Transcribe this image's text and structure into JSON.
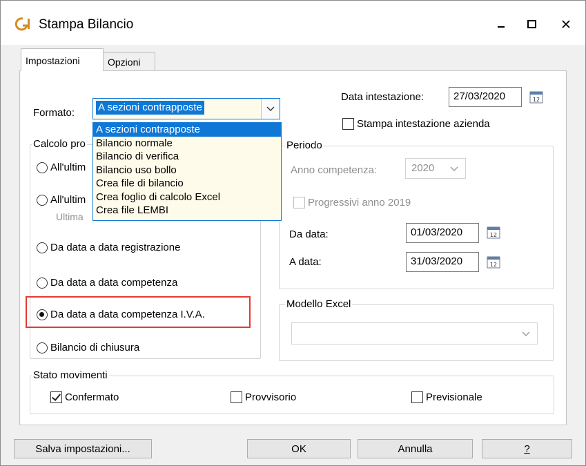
{
  "window": {
    "title": "Stampa Bilancio",
    "icon": "app-logo-icon",
    "controls": {
      "minimize": "minimize-icon",
      "maximize": "maximize-icon",
      "close": "close-icon"
    }
  },
  "tabs": [
    {
      "label": "Impostazioni",
      "active": true
    },
    {
      "label": "Opzioni",
      "active": false
    }
  ],
  "formato": {
    "label": "Formato:",
    "value": "A sezioni contrapposte",
    "options": [
      "A sezioni contrapposte",
      "Bilancio normale",
      "Bilancio di verifica",
      "Bilancio uso bollo",
      "Crea file di bilancio",
      "Crea foglio di calcolo Excel",
      "Crea file LEMBI"
    ]
  },
  "data_intestazione": {
    "label": "Data intestazione:",
    "value": "27/03/2020"
  },
  "stampa_intestazione": {
    "label": "Stampa intestazione azienda",
    "checked": false
  },
  "calcolo": {
    "title": "Calcolo pro",
    "options": [
      {
        "label": "All'ultim",
        "selected": false
      },
      {
        "label": "All'ultim",
        "selected": false
      },
      {
        "label": "Da data a data registrazione",
        "selected": false
      },
      {
        "label": "Da data a data competenza",
        "selected": false
      },
      {
        "label": "Da data a data competenza I.V.A.",
        "selected": true
      },
      {
        "label": "Bilancio di chiusura",
        "selected": false
      }
    ],
    "sublabel": "Ultima"
  },
  "periodo": {
    "title": "Periodo",
    "anno_label": "Anno competenza:",
    "anno_value": "2020",
    "progressivi_label": "Progressivi anno 2019",
    "da_data_label": "Da data:",
    "da_data_value": "01/03/2020",
    "a_data_label": "A data:",
    "a_data_value": "31/03/2020"
  },
  "modello_excel": {
    "title": "Modello Excel",
    "value": ""
  },
  "stato_movimenti": {
    "title": "Stato movimenti",
    "options": [
      {
        "label": "Confermato",
        "checked": true
      },
      {
        "label": "Provvisorio",
        "checked": false
      },
      {
        "label": "Previsionale",
        "checked": false
      }
    ]
  },
  "buttons": {
    "salva": "Salva impostazioni...",
    "ok": "OK",
    "annulla": "Annulla",
    "help": "?"
  },
  "colors": {
    "accent": "#0f78d7",
    "highlight": "#e53935",
    "dropdown_bg": "#fffbea"
  }
}
